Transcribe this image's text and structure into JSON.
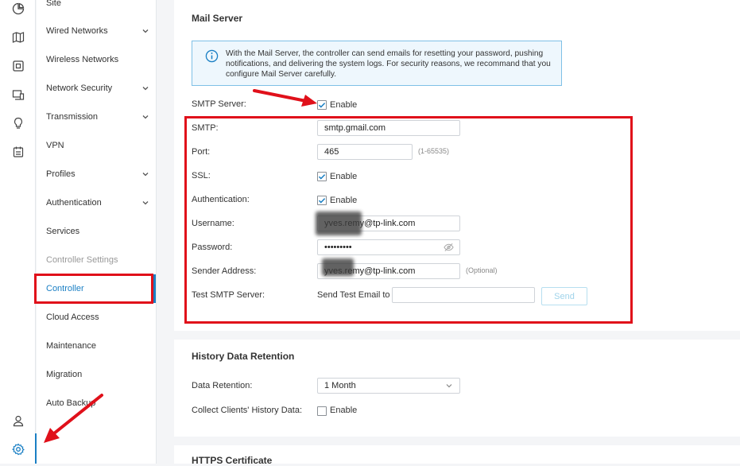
{
  "rail": {
    "icons": [
      "dashboard-icon",
      "map-icon",
      "device-icon",
      "devices-list-icon",
      "insights-icon",
      "log-icon",
      "account-icon",
      "settings-icon"
    ]
  },
  "menu": {
    "items": [
      {
        "label": "Site",
        "chevron": false
      },
      {
        "label": "Wired Networks",
        "chevron": true
      },
      {
        "label": "Wireless Networks",
        "chevron": false
      },
      {
        "label": "Network Security",
        "chevron": true
      },
      {
        "label": "Transmission",
        "chevron": true
      },
      {
        "label": "VPN",
        "chevron": false
      },
      {
        "label": "Profiles",
        "chevron": true
      },
      {
        "label": "Authentication",
        "chevron": true
      },
      {
        "label": "Services",
        "chevron": false
      },
      {
        "label": "Controller Settings",
        "chevron": false
      },
      {
        "label": "Controller",
        "chevron": false
      },
      {
        "label": "Cloud Access",
        "chevron": false
      },
      {
        "label": "Maintenance",
        "chevron": false
      },
      {
        "label": "Migration",
        "chevron": false
      },
      {
        "label": "Auto Backup",
        "chevron": false
      }
    ]
  },
  "mail_server": {
    "title": "Mail Server",
    "info": "With the Mail Server, the controller can send emails for resetting your password, pushing notifications, and delivering the system logs. For security reasons, we recommand that you configure Mail Server carefully.",
    "smtp_server_label": "SMTP Server:",
    "enable_label": "Enable",
    "smtp_label": "SMTP:",
    "smtp_value": "smtp.gmail.com",
    "port_label": "Port:",
    "port_value": "465",
    "port_hint": "(1-65535)",
    "ssl_label": "SSL:",
    "auth_label": "Authentication:",
    "username_label": "Username:",
    "username_value": "yves.remy@tp-link.com",
    "password_label": "Password:",
    "password_value": "•••••••••",
    "sender_label": "Sender Address:",
    "sender_value": "yves.remy@tp-link.com",
    "sender_hint": "(Optional)",
    "test_label": "Test SMTP Server:",
    "send_test_label": "Send Test Email to",
    "send_test_value": "",
    "send_button": "Send"
  },
  "history": {
    "title": "History Data Retention",
    "retention_label": "Data Retention:",
    "retention_value": "1 Month",
    "collect_label": "Collect Clients' History Data:",
    "enable_label": "Enable"
  },
  "https": {
    "title": "HTTPS Certificate"
  },
  "colors": {
    "accent": "#1a7fc4",
    "annotation": "#e0101a"
  }
}
